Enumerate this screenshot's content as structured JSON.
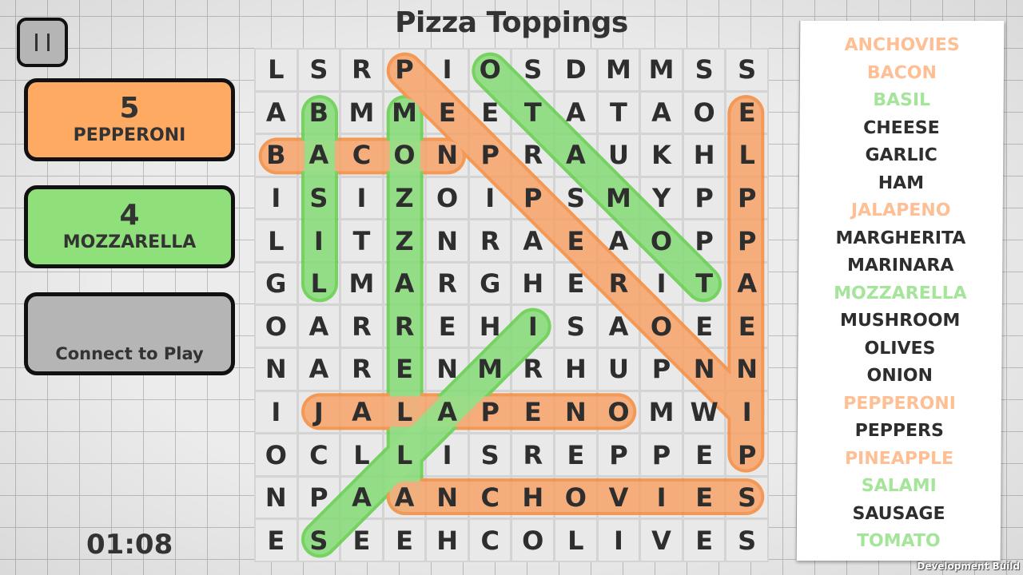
{
  "title": "Pizza Toppings",
  "pause_button": {
    "icon": "pause-icon"
  },
  "players": [
    {
      "score": "5",
      "name": "PEPPERONI",
      "color": "#ffaa62"
    },
    {
      "score": "4",
      "name": "MOZZARELLA",
      "color": "#8fe07a"
    },
    {
      "score": "",
      "name": "Connect to Play",
      "color": "#b5b5b5"
    }
  ],
  "timer": "01:08",
  "grid": [
    [
      "L",
      "S",
      "R",
      "P",
      "I",
      "O",
      "S",
      "D",
      "M",
      "M",
      "S",
      "S"
    ],
    [
      "A",
      "B",
      "M",
      "M",
      "E",
      "E",
      "T",
      "A",
      "T",
      "A",
      "O",
      "E"
    ],
    [
      "B",
      "A",
      "C",
      "O",
      "N",
      "P",
      "R",
      "A",
      "U",
      "K",
      "H",
      "L"
    ],
    [
      "I",
      "S",
      "I",
      "Z",
      "O",
      "I",
      "P",
      "S",
      "M",
      "Y",
      "P",
      "P"
    ],
    [
      "L",
      "I",
      "T",
      "Z",
      "N",
      "R",
      "A",
      "E",
      "A",
      "O",
      "P",
      "P"
    ],
    [
      "G",
      "L",
      "M",
      "A",
      "R",
      "G",
      "H",
      "E",
      "R",
      "I",
      "T",
      "A"
    ],
    [
      "O",
      "A",
      "R",
      "R",
      "E",
      "H",
      "I",
      "S",
      "A",
      "O",
      "E",
      "E"
    ],
    [
      "N",
      "A",
      "R",
      "E",
      "N",
      "M",
      "R",
      "H",
      "U",
      "P",
      "N",
      "N"
    ],
    [
      "I",
      "J",
      "A",
      "L",
      "A",
      "P",
      "E",
      "N",
      "O",
      "M",
      "W",
      "I"
    ],
    [
      "O",
      "C",
      "L",
      "L",
      "I",
      "S",
      "R",
      "E",
      "P",
      "P",
      "E",
      "P"
    ],
    [
      "N",
      "P",
      "A",
      "A",
      "N",
      "C",
      "H",
      "O",
      "V",
      "I",
      "E",
      "S"
    ],
    [
      "E",
      "S",
      "E",
      "E",
      "H",
      "C",
      "O",
      "L",
      "I",
      "V",
      "E",
      "S"
    ]
  ],
  "highlights": [
    {
      "word": "BACON",
      "player": "orange",
      "start": [
        2,
        0
      ],
      "end": [
        2,
        4
      ]
    },
    {
      "word": "BASIL",
      "player": "green",
      "start": [
        1,
        1
      ],
      "end": [
        5,
        1
      ]
    },
    {
      "word": "MOZZARELLA",
      "player": "green",
      "start": [
        1,
        3
      ],
      "end": [
        10,
        3
      ]
    },
    {
      "word": "PEPPERONI",
      "player": "orange",
      "start": [
        0,
        3
      ],
      "end": [
        8,
        11
      ]
    },
    {
      "word": "TOMATO",
      "player": "green",
      "start": [
        5,
        10
      ],
      "end": [
        0,
        5
      ]
    },
    {
      "word": "PINEAPPLE",
      "player": "orange",
      "start": [
        9,
        11
      ],
      "end": [
        1,
        11
      ]
    },
    {
      "word": "JALAPENO",
      "player": "orange",
      "start": [
        8,
        1
      ],
      "end": [
        8,
        8
      ]
    },
    {
      "word": "SALAMI",
      "player": "green",
      "start": [
        11,
        1
      ],
      "end": [
        6,
        6
      ]
    },
    {
      "word": "ANCHOVIES",
      "player": "orange",
      "start": [
        10,
        3
      ],
      "end": [
        10,
        11
      ]
    }
  ],
  "highlight_colors": {
    "orange": {
      "fill": "#f5a46a",
      "stroke": "#f58b3c"
    },
    "green": {
      "fill": "#88dc78",
      "stroke": "#62cf4a"
    }
  },
  "words": [
    {
      "text": "ANCHOVIES",
      "found_by": "orange"
    },
    {
      "text": "BACON",
      "found_by": "orange"
    },
    {
      "text": "BASIL",
      "found_by": "green"
    },
    {
      "text": "CHEESE",
      "found_by": ""
    },
    {
      "text": "GARLIC",
      "found_by": ""
    },
    {
      "text": "HAM",
      "found_by": ""
    },
    {
      "text": "JALAPENO",
      "found_by": "orange"
    },
    {
      "text": "MARGHERITA",
      "found_by": ""
    },
    {
      "text": "MARINARA",
      "found_by": ""
    },
    {
      "text": "MOZZARELLA",
      "found_by": "green"
    },
    {
      "text": "MUSHROOM",
      "found_by": ""
    },
    {
      "text": "OLIVES",
      "found_by": ""
    },
    {
      "text": "ONION",
      "found_by": ""
    },
    {
      "text": "PEPPERONI",
      "found_by": "orange"
    },
    {
      "text": "PEPPERS",
      "found_by": ""
    },
    {
      "text": "PINEAPPLE",
      "found_by": "orange"
    },
    {
      "text": "SALAMI",
      "found_by": "green"
    },
    {
      "text": "SAUSAGE",
      "found_by": ""
    },
    {
      "text": "TOMATO",
      "found_by": "green"
    }
  ],
  "dev_build_label": "Development Build"
}
